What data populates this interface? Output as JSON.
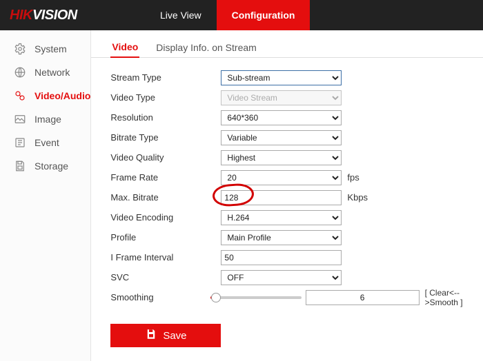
{
  "brand": {
    "hik": "HIK",
    "vision": "VISION"
  },
  "topnav": {
    "items": [
      "Live View",
      "Configuration"
    ],
    "activeIndex": 1
  },
  "sidebar": {
    "items": [
      {
        "label": "System"
      },
      {
        "label": "Network"
      },
      {
        "label": "Video/Audio"
      },
      {
        "label": "Image"
      },
      {
        "label": "Event"
      },
      {
        "label": "Storage"
      }
    ],
    "activeIndex": 2
  },
  "tabs": {
    "items": [
      "Video",
      "Display Info. on Stream"
    ],
    "activeIndex": 0
  },
  "labels": {
    "stream_type": "Stream Type",
    "video_type": "Video Type",
    "resolution": "Resolution",
    "bitrate_type": "Bitrate Type",
    "video_quality": "Video Quality",
    "frame_rate": "Frame Rate",
    "max_bitrate": "Max. Bitrate",
    "video_encoding": "Video Encoding",
    "profile": "Profile",
    "iframe": "I Frame Interval",
    "svc": "SVC",
    "smoothing": "Smoothing"
  },
  "values": {
    "stream_type": "Sub-stream",
    "video_type": "Video Stream",
    "resolution": "640*360",
    "bitrate_type": "Variable",
    "video_quality": "Highest",
    "frame_rate": "20",
    "max_bitrate": "128",
    "video_encoding": "H.264",
    "profile": "Main Profile",
    "iframe": "50",
    "svc": "OFF",
    "smoothing": "6"
  },
  "units": {
    "fps": "fps",
    "kbps": "Kbps"
  },
  "smoothing_hint": "[ Clear<-->Smooth ]",
  "save_label": "Save"
}
